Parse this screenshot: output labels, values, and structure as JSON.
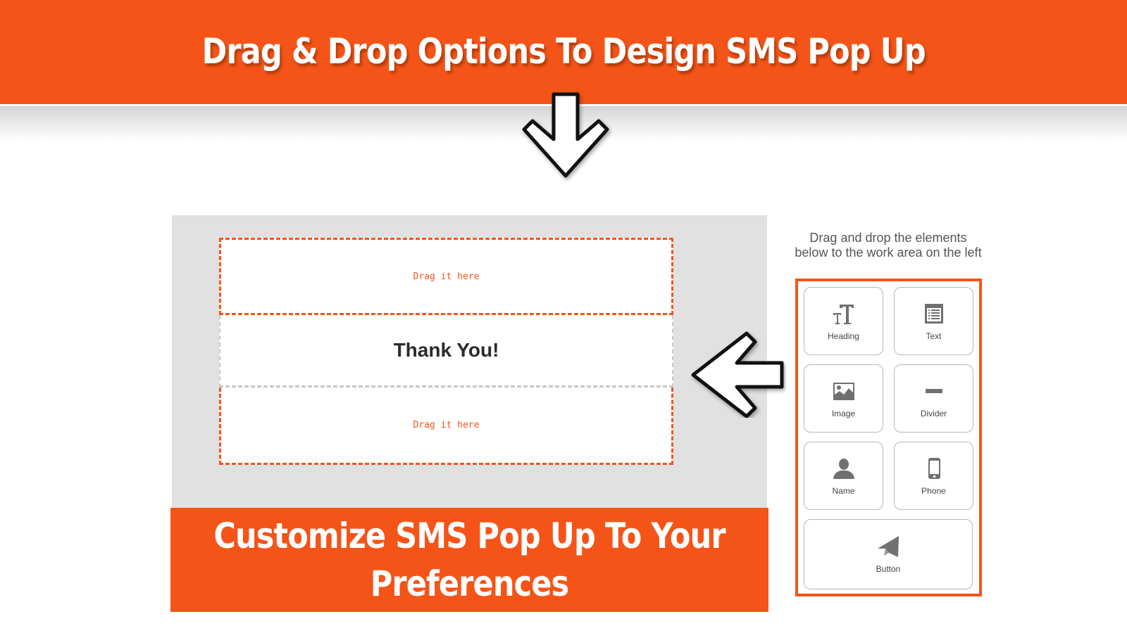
{
  "header": {
    "title": "Drag & Drop Options To Design SMS Pop Up"
  },
  "workarea": {
    "dropzone_top_label": "Drag it here",
    "heading_text": "Thank You!",
    "dropzone_bottom_label": "Drag it here"
  },
  "caption": {
    "text": "Customize SMS Pop Up To Your Preferences"
  },
  "palette": {
    "instructions": "Drag and drop the elements below to the work area on the left",
    "items": [
      {
        "label": "Heading",
        "icon": "heading-icon"
      },
      {
        "label": "Text",
        "icon": "text-list-icon"
      },
      {
        "label": "Image",
        "icon": "image-icon"
      },
      {
        "label": "Divider",
        "icon": "divider-icon"
      },
      {
        "label": "Name",
        "icon": "user-icon"
      },
      {
        "label": "Phone",
        "icon": "phone-icon"
      },
      {
        "label": "Button",
        "icon": "paper-plane-icon"
      }
    ]
  },
  "colors": {
    "brand": "#f55418",
    "workarea_bg": "#e1e1e1",
    "icon_gray": "#707070"
  }
}
